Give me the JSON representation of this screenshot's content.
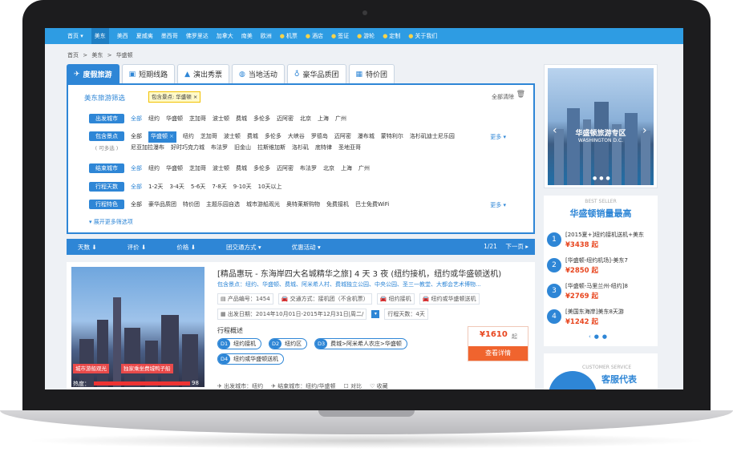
{
  "topnav": {
    "items": [
      "首页 ▾",
      "美东",
      "美西",
      "夏威夷",
      "墨西哥",
      "佛罗里达",
      "加拿大",
      "南美",
      "欧洲",
      "机票",
      "酒店",
      "签证",
      "游轮",
      "定制",
      "关于我们"
    ]
  },
  "breadcrumb": [
    "首页",
    ">",
    "美东",
    ">",
    "华盛顿"
  ],
  "tabs": [
    "度假旅游",
    "短期线路",
    "演出秀票",
    "当地活动",
    "豪华品质团",
    "特价团"
  ],
  "filter": {
    "title": "美东旅游筛选",
    "chosen": "包含景点: 华盛顿 ×",
    "clear_all": "全部清除",
    "expand_more": "▾ 展开更多筛选项",
    "more": "更多 ▾",
    "rows": {
      "departure": {
        "label": "出发城市",
        "items": [
          "全部",
          "纽约",
          "华盛顿",
          "芝加哥",
          "波士顿",
          "费城",
          "多伦多",
          "迈阿密",
          "北京",
          "上海",
          "广州"
        ]
      },
      "spots": {
        "label": "包含景点",
        "sub": "( 可多选 )",
        "items": [
          "全部",
          "华盛顿",
          "纽约",
          "芝加哥",
          "波士顿",
          "费城",
          "多伦多",
          "大峡谷",
          "罗德岛",
          "迈阿密",
          "瀑布城",
          "蒙特利尔",
          "洛杉矶迪士尼乐园",
          "尼亚加拉瀑布",
          "好时巧克力城",
          "布法罗",
          "旧金山",
          "拉斯维加斯",
          "洛杉矶",
          "底特律",
          "圣地亚哥"
        ]
      },
      "end": {
        "label": "结束城市",
        "items": [
          "全部",
          "纽约",
          "华盛顿",
          "芝加哥",
          "波士顿",
          "费城",
          "多伦多",
          "迈阿密",
          "布法罗",
          "北京",
          "上海",
          "广州"
        ]
      },
      "days": {
        "label": "行程天数",
        "items": [
          "全部",
          "1-2天",
          "3-4天",
          "5-6天",
          "7-8天",
          "9-10天",
          "10天以上"
        ]
      },
      "features": {
        "label": "行程特色",
        "items": [
          "全部",
          "豪华品质团",
          "特价团",
          "主题乐园自选",
          "城市游船观光",
          "奥特莱斯购物",
          "免费接机",
          "巴士免费WiFi"
        ]
      }
    }
  },
  "sortbar": {
    "items": [
      "天数 ⬇",
      "评价 ⬇",
      "价格 ⬇",
      "团交通方式 ▾",
      "优惠活动 ▾"
    ],
    "page": "1/21",
    "next": "下一页 ▸"
  },
  "product": {
    "title": "[精品惠玩 - 东海岸四大名城精华之旅] 4 天 3 夜 (纽约接机，纽约或华盛顿送机)",
    "spots": "包含景点：纽约、华盛顿、费城、阿米希人村、费城独立公园、中央公园、圣三一教堂、大都会艺术博物...",
    "meta": [
      "产品编号：1454",
      "交通方式：接机团（不含机票）",
      "纽约接机",
      "纽约或华盛顿送机"
    ],
    "date": "出发日期：2014年10月01日-2015年12月31日|周二/",
    "days": "行程天数：4天",
    "overview_title": "行程概述",
    "itinerary": [
      {
        "day": "D1",
        "text": "纽约接机"
      },
      {
        "day": "D2",
        "text": "纽约区"
      },
      {
        "day": "D3",
        "text": "费城>阿米希人农庄>华盛顿"
      },
      {
        "day": "D4",
        "text": "纽约或华盛顿送机"
      }
    ],
    "price": "¥1610",
    "price_unit": "起",
    "detail_button": "查看详情",
    "img_tags": [
      "城市游船观光",
      "独家乘坐费城鸭子船"
    ],
    "heat_label": "热度：",
    "heat_value": "98",
    "bottom": [
      "出发城市：纽约",
      "结束城市：纽约/华盛顿",
      "对比",
      "收藏"
    ]
  },
  "side_banner": {
    "title": "华盛顿旅游专区",
    "sub": "WASHINGTON D.C."
  },
  "bestseller": {
    "en": "BEST SELLER",
    "title": "华盛顿销量最高",
    "items": [
      {
        "num": "1",
        "name": "[2015夏+]纽约接机送机+美东",
        "price": "¥3438 起"
      },
      {
        "num": "2",
        "name": "[华盛顿-纽约机场]-美东7",
        "price": "¥2850 起"
      },
      {
        "num": "3",
        "name": "[华盛顿-马里兰州-纽约]8",
        "price": "¥2769 起"
      },
      {
        "num": "4",
        "name": "[美国东海岸]美东8天游",
        "price": "¥1242 起"
      }
    ]
  },
  "customer": {
    "en": "CUSTOMER SERVICE",
    "title": "客服代表"
  }
}
